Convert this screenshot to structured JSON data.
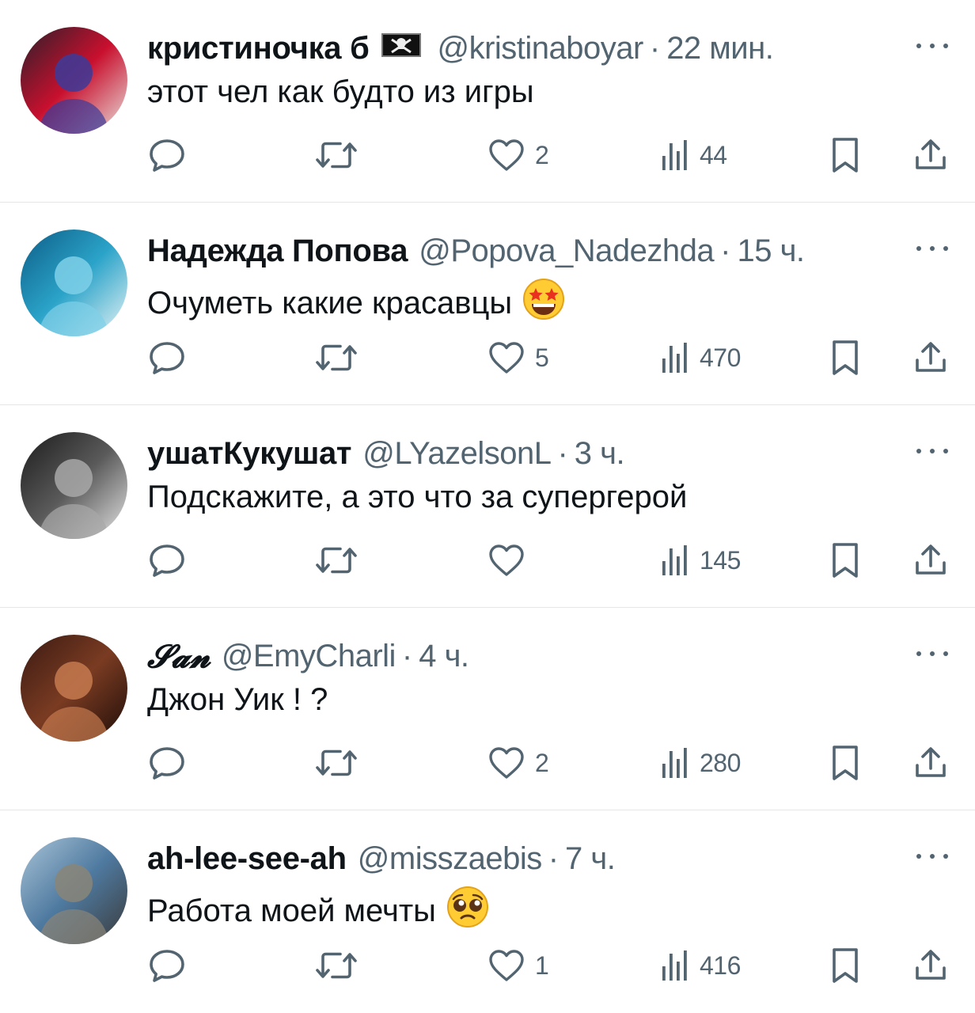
{
  "replies": [
    {
      "name": "кристиночка б",
      "has_flag": true,
      "flag_icon": "pirate-flag-icon",
      "handle": "@kristinaboyar",
      "separator": "·",
      "time": "22 мин.",
      "text": "этот чел как будто из игры",
      "emoji_icon": "",
      "likes": "2",
      "views": "44",
      "avatar_colors": [
        "#2a1f2a",
        "#c8102e",
        "#3b3b9a",
        "#e9e2dd"
      ]
    },
    {
      "name": "Надежда Попова",
      "has_flag": false,
      "handle": "@Popova_Nadezhda",
      "separator": "·",
      "time": "15 ч.",
      "text": "Очуметь какие красавцы",
      "emoji_icon": "star-struck-emoji-icon",
      "likes": "5",
      "views": "470",
      "avatar_colors": [
        "#0d5d86",
        "#2ba3c9",
        "#7fd0e8",
        "#e8f4f6"
      ]
    },
    {
      "name": "ушатКукушат",
      "has_flag": false,
      "handle": "@LYazelsonL",
      "separator": "·",
      "time": "3 ч.",
      "text": "Подскажите, а это что за супергерой",
      "emoji_icon": "",
      "likes": "",
      "views": "145",
      "avatar_colors": [
        "#1b1b1b",
        "#5a5a5a",
        "#a8a8a8",
        "#e6e6e6"
      ]
    },
    {
      "name": "𝓢𝓪𝓷",
      "has_flag": false,
      "handle": "@EmyCharli",
      "separator": "·",
      "time": "4 ч.",
      "text": "Джон Уик ! ?",
      "emoji_icon": "",
      "likes": "2",
      "views": "280",
      "avatar_colors": [
        "#3a1a12",
        "#7a3b22",
        "#c67a4f",
        "#1d0d08"
      ]
    },
    {
      "name": "ah-lee-see-ah",
      "has_flag": false,
      "handle": "@misszaebis",
      "separator": "·",
      "time": "7 ч.",
      "text": "Работа моей мечты",
      "emoji_icon": "pleading-face-emoji-icon",
      "likes": "1",
      "views": "416",
      "avatar_colors": [
        "#a9c4d8",
        "#4f7aa0",
        "#8a8578",
        "#3a3a3a"
      ]
    }
  ],
  "icons": {
    "reply": "reply-icon",
    "retweet": "retweet-icon",
    "like": "heart-icon",
    "views": "views-icon",
    "bookmark": "bookmark-icon",
    "share": "share-icon",
    "more": "more-icon"
  },
  "colors": {
    "text": "#0f1419",
    "secondary": "#536471",
    "divider": "#e4e7ea"
  }
}
